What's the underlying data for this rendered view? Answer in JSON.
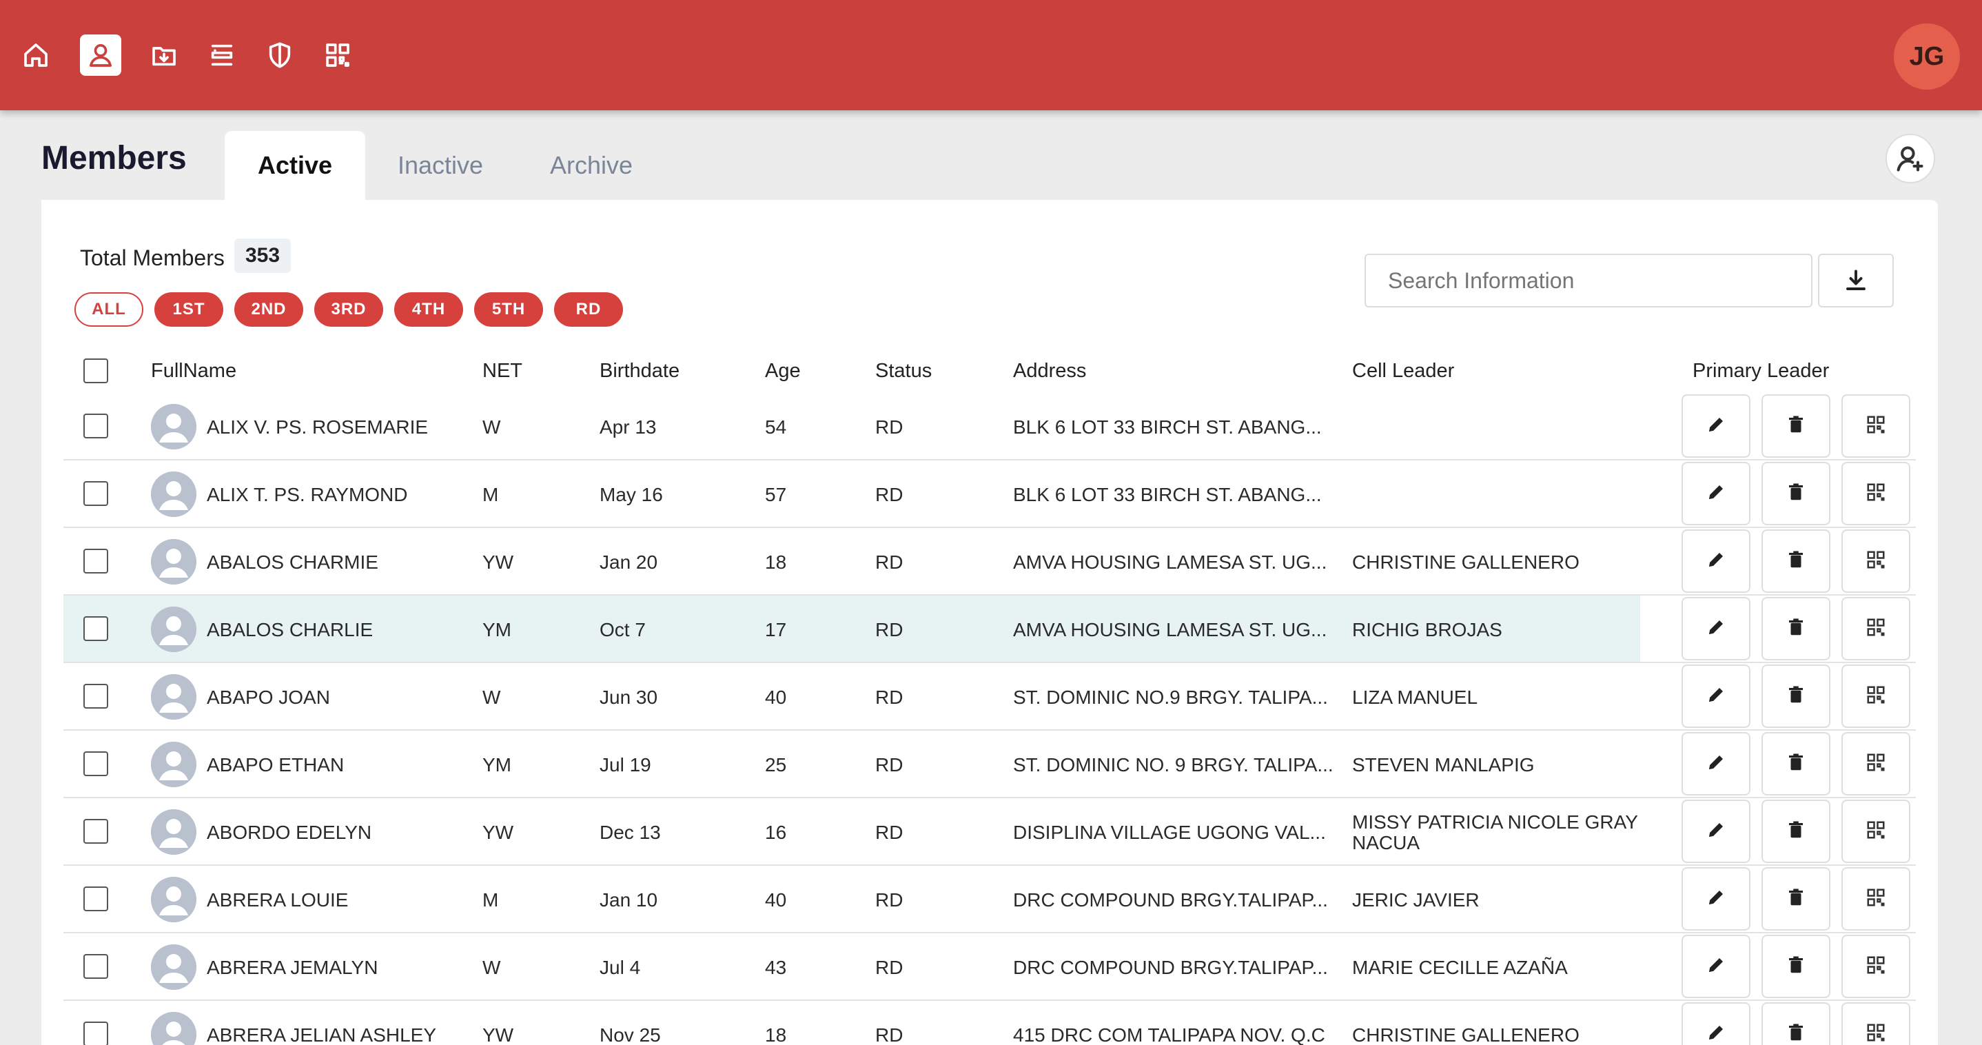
{
  "header": {
    "nav": [
      {
        "name": "home-icon",
        "active": false
      },
      {
        "name": "user-icon",
        "active": true
      },
      {
        "name": "folder-download-icon",
        "active": false
      },
      {
        "name": "list-icon",
        "active": false
      },
      {
        "name": "shield-icon",
        "active": false
      },
      {
        "name": "qr-code-icon",
        "active": false
      }
    ],
    "user_initials": "JG"
  },
  "page": {
    "title": "Members",
    "tabs": [
      "Active",
      "Inactive",
      "Archive"
    ],
    "active_tab": "Active"
  },
  "summary": {
    "total_label": "Total Members",
    "total_count": "353"
  },
  "filters": [
    "ALL",
    "1ST",
    "2ND",
    "3RD",
    "4TH",
    "5TH",
    "RD"
  ],
  "selected_filter": "ALL",
  "search": {
    "placeholder": "Search Information"
  },
  "table": {
    "columns": [
      "FullName",
      "NET",
      "Birthdate",
      "Age",
      "Status",
      "Address",
      "Cell Leader",
      "Primary Leader"
    ],
    "rows": [
      {
        "name": "ALIX V. PS. ROSEMARIE",
        "net": "W",
        "birthdate": "Apr 13",
        "age": "54",
        "status": "RD",
        "address": "BLK 6 LOT 33 BIRCH ST. ABANG...",
        "cell_leader": ""
      },
      {
        "name": "ALIX T. PS. RAYMOND",
        "net": "M",
        "birthdate": "May 16",
        "age": "57",
        "status": "RD",
        "address": "BLK 6 LOT 33 BIRCH ST. ABANG...",
        "cell_leader": ""
      },
      {
        "name": "ABALOS CHARMIE",
        "net": "YW",
        "birthdate": "Jan 20",
        "age": "18",
        "status": "RD",
        "address": "AMVA HOUSING LAMESA ST. UG...",
        "cell_leader": "CHRISTINE GALLENERO"
      },
      {
        "name": "ABALOS CHARLIE",
        "net": "YM",
        "birthdate": "Oct 7",
        "age": "17",
        "status": "RD",
        "address": "AMVA HOUSING LAMESA ST. UG...",
        "cell_leader": "RICHIG BROJAS"
      },
      {
        "name": "ABAPO JOAN",
        "net": "W",
        "birthdate": "Jun 30",
        "age": "40",
        "status": "RD",
        "address": "ST. DOMINIC NO.9 BRGY. TALIPA...",
        "cell_leader": "LIZA MANUEL"
      },
      {
        "name": "ABAPO ETHAN",
        "net": "YM",
        "birthdate": "Jul 19",
        "age": "25",
        "status": "RD",
        "address": "ST. DOMINIC NO. 9 BRGY. TALIPA...",
        "cell_leader": "STEVEN MANLAPIG"
      },
      {
        "name": "ABORDO EDELYN",
        "net": "YW",
        "birthdate": "Dec 13",
        "age": "16",
        "status": "RD",
        "address": "DISIPLINA VILLAGE UGONG VAL...",
        "cell_leader": "MISSY PATRICIA NICOLE GRAY NACUA"
      },
      {
        "name": "ABRERA LOUIE",
        "net": "M",
        "birthdate": "Jan 10",
        "age": "40",
        "status": "RD",
        "address": "DRC COMPOUND BRGY.TALIPAP...",
        "cell_leader": "JERIC JAVIER"
      },
      {
        "name": "ABRERA JEMALYN",
        "net": "W",
        "birthdate": "Jul 4",
        "age": "43",
        "status": "RD",
        "address": "DRC COMPOUND BRGY.TALIPAP...",
        "cell_leader": "MARIE CECILLE AZAÑA"
      },
      {
        "name": "ABRERA JELIAN ASHLEY",
        "net": "YW",
        "birthdate": "Nov 25",
        "age": "18",
        "status": "RD",
        "address": "415 DRC COM TALIPAPA NOV. Q.C",
        "cell_leader": "CHRISTINE GALLENERO"
      }
    ],
    "highlighted_row": 3
  },
  "colors": {
    "brand": "#c9403d",
    "chip": "#d6413d",
    "highlight": "#e6f3f2"
  }
}
